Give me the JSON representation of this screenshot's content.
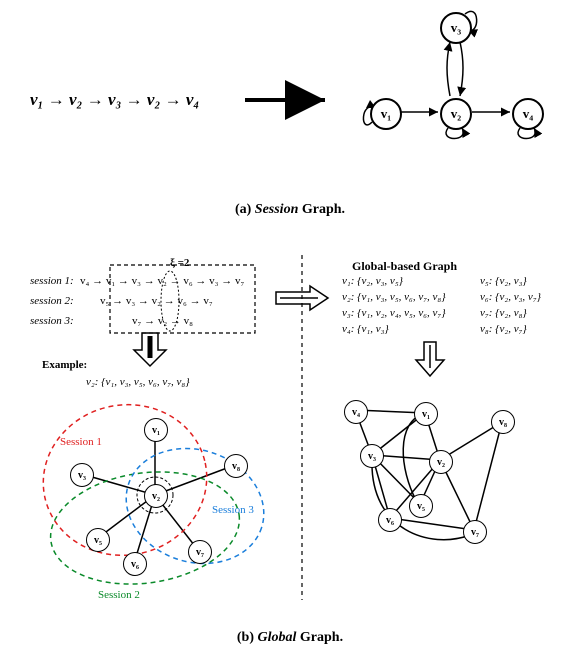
{
  "panel_a": {
    "caption_prefix": "(a) ",
    "caption_italic": "Session",
    "caption_suffix": " Graph.",
    "sequence": "v₁ → v₂ → v₃ → v₂ → v₄",
    "nodes": {
      "n1": "v₁",
      "n2": "v₂",
      "n3": "v₃",
      "n4": "v₄"
    }
  },
  "panel_b": {
    "caption_prefix": "(b) ",
    "caption_italic": "Global",
    "caption_suffix": " Graph.",
    "xi_label": "ξ =2",
    "session1_label": "session 1:",
    "session1_seq": "v₄ → v₁ → v₃ → v₂ → v₆ → v₃ → v₇",
    "session2_label": "session 2:",
    "session2_seq": "v₅ → v₃ → v₂ → v₆ → v₇",
    "session3_label": "session 3:",
    "session3_seq": "v₇ → v₂ → v₈",
    "example_label": "Example:",
    "example_text": "v₂: {v₁, v₃, v₅, v₆, v₇, v₈}",
    "global_title": "Global-based Graph",
    "adj_v1": "v₁: {v₂, v₃, v₅}",
    "adj_v2": "v₂: {v₁, v₃, v₅, v₆, v₇, v₈}",
    "adj_v3": "v₃: {v₁, v₂, v₄, v₅, v₆, v₇}",
    "adj_v4": "v₄: {v₁, v₃}",
    "adj_v5": "v₅: {v₂, v₃}",
    "adj_v6": "v₆: {v₂, v₃, v₇}",
    "adj_v7": "v₇: {v₂, v₈}",
    "adj_v8": "v₈: {v₂, v₇}",
    "labels": {
      "sess1": "Session 1",
      "sess2": "Session 2",
      "sess3": "Session 3"
    },
    "left_nodes": {
      "v1": "v₁",
      "v2": "v₂",
      "v3": "v₃",
      "v5": "v₅",
      "v6": "v₆",
      "v7": "v₇",
      "v8": "v₈"
    },
    "right_nodes": {
      "v1": "v₁",
      "v2": "v₂",
      "v3": "v₃",
      "v4": "v₄",
      "v5": "v₅",
      "v6": "v₆",
      "v7": "v₇",
      "v8": "v₈"
    }
  }
}
